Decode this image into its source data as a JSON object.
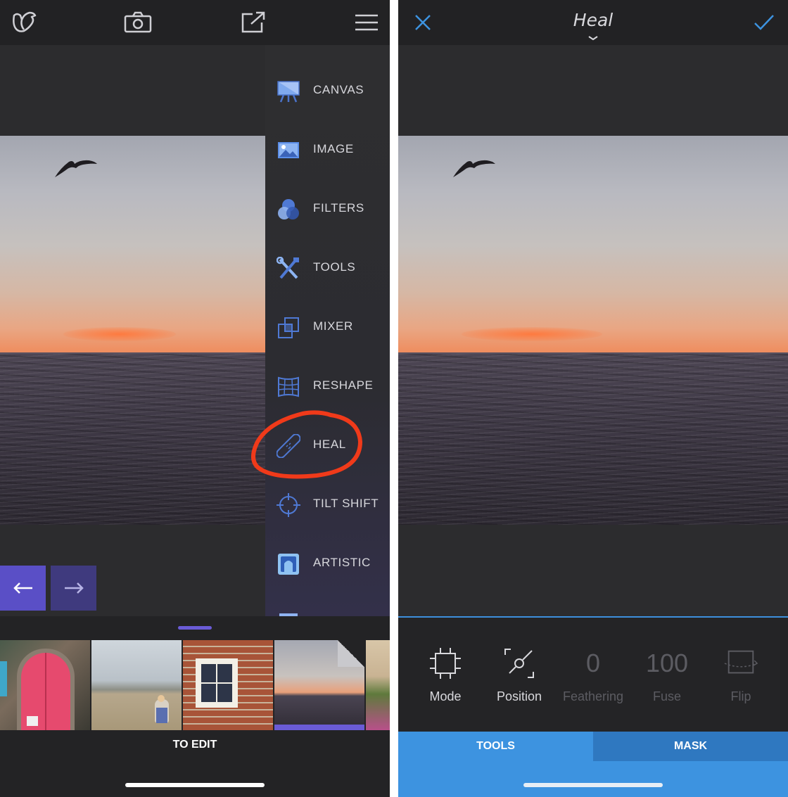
{
  "left_screen": {
    "topbar": {
      "icons": [
        "bird-logo-icon",
        "camera-icon",
        "share-icon",
        "hamburger-menu-icon"
      ]
    },
    "menu": [
      {
        "label": "CANVAS",
        "icon": "canvas-easel-icon"
      },
      {
        "label": "IMAGE",
        "icon": "image-landscape-icon"
      },
      {
        "label": "FILTERS",
        "icon": "filters-circles-icon"
      },
      {
        "label": "TOOLS",
        "icon": "tools-wrench-icon"
      },
      {
        "label": "MIXER",
        "icon": "mixer-layers-icon"
      },
      {
        "label": "RESHAPE",
        "icon": "reshape-grid-icon"
      },
      {
        "label": "HEAL",
        "icon": "heal-bandage-icon"
      },
      {
        "label": "TILT SHIFT",
        "icon": "tilt-shift-crosshair-icon"
      },
      {
        "label": "ARTISTIC",
        "icon": "artistic-frame-icon"
      }
    ],
    "nav": {
      "back_icon": "arrow-left-icon",
      "forward_icon": "arrow-right-icon"
    },
    "bottom": {
      "label": "TO EDIT",
      "thumbnails": [
        "red-door-thumbnail",
        "beach-child-thumbnail",
        "brick-window-thumbnail",
        "sea-sunset-thumbnail"
      ]
    },
    "accent_color": "#6a5bd6",
    "annotation_color": "#f03a1a"
  },
  "right_screen": {
    "title": "Heal",
    "tools": [
      {
        "label": "Mode",
        "icon": "mode-crop-icon",
        "enabled": true
      },
      {
        "label": "Position",
        "icon": "position-target-icon",
        "enabled": true
      },
      {
        "label": "Feathering",
        "value": "0",
        "enabled": false
      },
      {
        "label": "Fuse",
        "value": "100",
        "enabled": false
      },
      {
        "label": "Flip",
        "icon": "flip-icon",
        "enabled": false
      }
    ],
    "tabs": {
      "tools": "TOOLS",
      "mask": "MASK"
    },
    "accent_color": "#3d93e0"
  }
}
